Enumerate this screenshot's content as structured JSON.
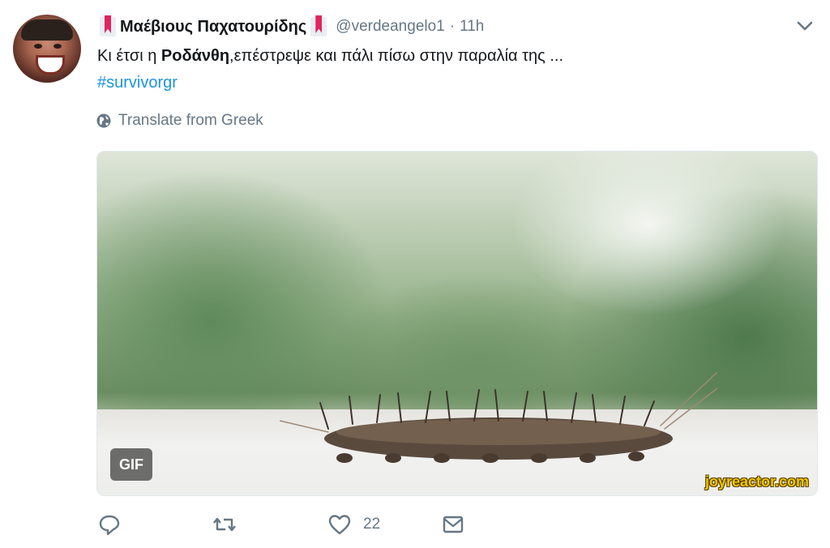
{
  "author": {
    "name": "Μαέβιους Παχατουρίδης",
    "handle": "@verdeangelo1",
    "time": "11h"
  },
  "tweet": {
    "text_before": "Κι έτσι η ",
    "text_bold": "Ροδάνθη",
    "text_after": ",επέστρεψε και πάλι πίσω στην παραλία της ...",
    "hashtag": "#survivorgr",
    "translate_label": "Translate from Greek"
  },
  "media": {
    "badge": "GIF",
    "watermark": "joyreactor.com"
  },
  "actions": {
    "reply_count": "",
    "retweet_count": "",
    "like_count": "22",
    "dm_count": ""
  },
  "colors": {
    "link": "#1c94e0",
    "muted": "#657786",
    "text": "#14171a"
  },
  "icons": [
    "bookmark-flag-icon",
    "chevron-down-icon",
    "globe-icon",
    "reply-icon",
    "retweet-icon",
    "heart-icon",
    "envelope-icon"
  ]
}
